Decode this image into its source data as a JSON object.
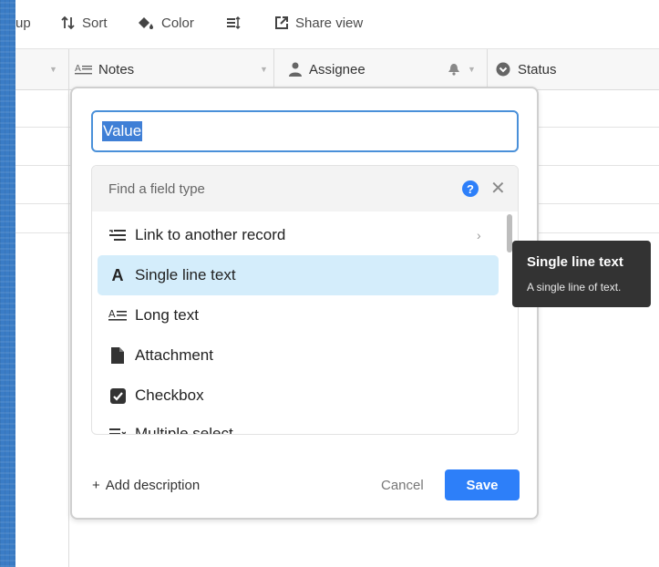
{
  "toolbar": {
    "group_partial": "up",
    "sort_label": "Sort",
    "color_label": "Color",
    "share_label": "Share view"
  },
  "columns": {
    "notes": "Notes",
    "assignee": "Assignee",
    "status": "Status"
  },
  "dialog": {
    "field_name_value": "Value",
    "search_placeholder": "Find a field type",
    "field_types": [
      {
        "label": "Link to another record",
        "icon": "link-record-icon",
        "has_submenu": true
      },
      {
        "label": "Single line text",
        "icon": "single-line-text-icon",
        "selected": true
      },
      {
        "label": "Long text",
        "icon": "long-text-icon"
      },
      {
        "label": "Attachment",
        "icon": "attachment-icon"
      },
      {
        "label": "Checkbox",
        "icon": "checkbox-icon"
      },
      {
        "label": "Multiple select",
        "icon": "multiple-select-icon"
      }
    ],
    "add_description": "Add description",
    "cancel_label": "Cancel",
    "save_label": "Save"
  },
  "tooltip": {
    "title": "Single line text",
    "description": "A single line of text."
  },
  "colors": {
    "accent": "#2d7ff9",
    "selected_row": "#d4edfb",
    "tooltip_bg": "#333333"
  }
}
